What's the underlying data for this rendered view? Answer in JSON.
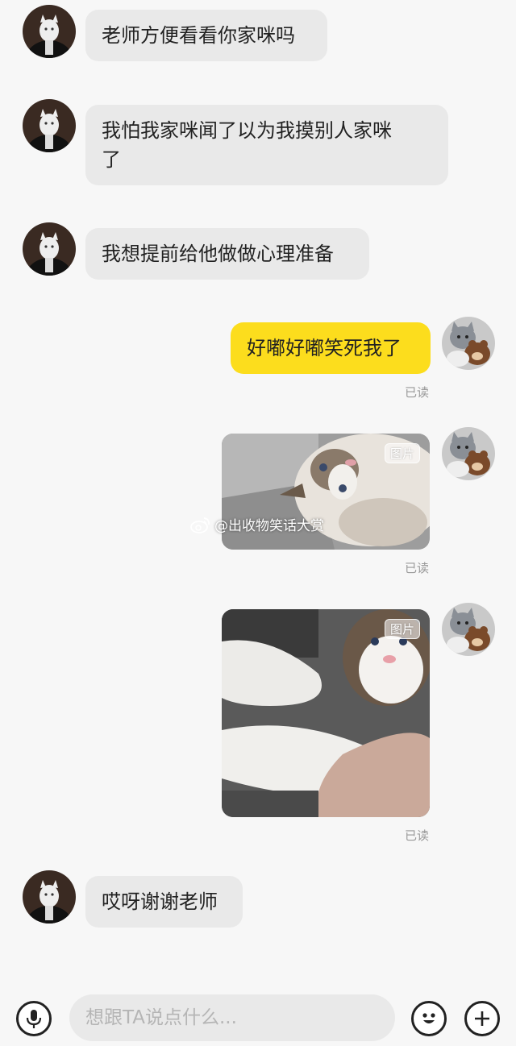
{
  "messages": [
    {
      "id": "m1",
      "from": "other",
      "text": "老师方便看看你家咪吗"
    },
    {
      "id": "m2",
      "from": "other",
      "line1": "我怕我家咪闻了以为我摸别人家咪",
      "line2": "了"
    },
    {
      "id": "m3",
      "from": "other",
      "text": "我想提前给他做做心理准备"
    },
    {
      "id": "m4",
      "from": "me",
      "text": "好嘟好嘟笑死我了",
      "status": "已读"
    },
    {
      "id": "m5",
      "from": "me",
      "type": "image",
      "tag": "图片",
      "status": "已读"
    },
    {
      "id": "m6",
      "from": "me",
      "type": "image",
      "tag": "图片",
      "status": "已读"
    },
    {
      "id": "m7",
      "from": "other",
      "text": "哎呀谢谢老师"
    }
  ],
  "watermark": {
    "text": "@出收物笑话大赏",
    "icon": "weibo-icon"
  },
  "input": {
    "placeholder": "想跟TA说点什么..."
  },
  "icons": {
    "voice": "microphone-icon",
    "emoji": "emoji-icon",
    "more": "plus-icon"
  },
  "colors": {
    "my_bubble": "#fcdd1d",
    "other_bubble": "#e9e9e9",
    "background": "#f7f7f7",
    "read_status": "#999999"
  }
}
